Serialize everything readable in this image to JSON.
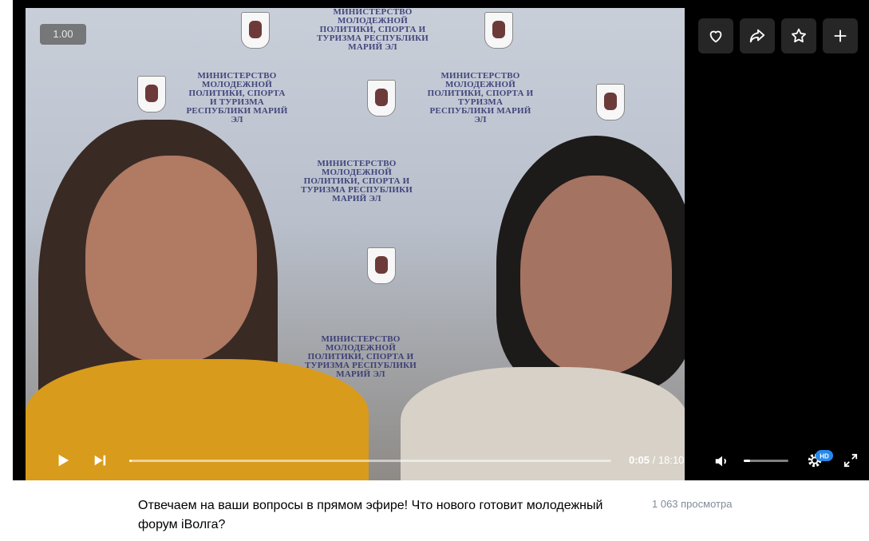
{
  "player": {
    "speed_badge": "1.00",
    "time_current": "0:05",
    "time_separator": " / ",
    "time_total": "18:10",
    "progress_fraction": 0.005,
    "volume_fraction": 0.15,
    "hd_badge": "HD",
    "top_actions": [
      {
        "name": "like-button",
        "icon": "heart-icon"
      },
      {
        "name": "share-button",
        "icon": "share-arrow-icon"
      },
      {
        "name": "favorite-button",
        "icon": "star-icon"
      },
      {
        "name": "add-button",
        "icon": "plus-icon"
      }
    ]
  },
  "backdrop": {
    "ministry_label": "МИНИСТЕРСТВО МОЛОДЕЖНОЙ ПОЛИТИКИ, СПОРТА И ТУРИЗМА РЕСПУБЛИКИ МАРИЙ ЭЛ"
  },
  "video": {
    "title": "Отвечаем на ваши вопросы в прямом эфире! Что нового готовит молодежный форум iВолга?",
    "views": "1 063 просмотра"
  },
  "colors": {
    "player_bg": "#000000",
    "views_text": "#818c99",
    "hd_badge": "#2688eb"
  }
}
